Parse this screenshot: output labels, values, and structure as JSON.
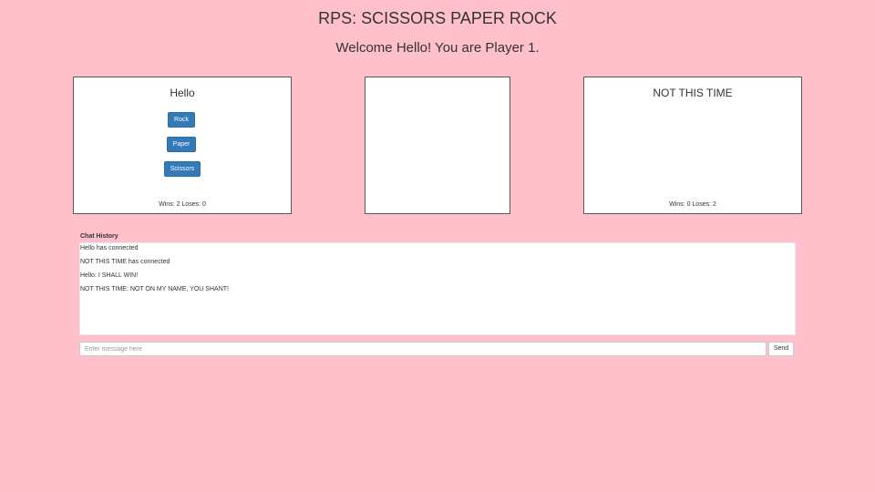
{
  "header": {
    "title": "RPS: SCISSORS PAPER ROCK",
    "welcome": "Welcome Hello! You are Player 1."
  },
  "player1": {
    "name": "Hello",
    "choices": [
      "Rock",
      "Paper",
      "Scissors"
    ],
    "record": "Wins: 2 Loses: 0"
  },
  "result": {
    "text": ""
  },
  "player2": {
    "name": "NOT THIS TIME",
    "record": "Wins: 0 Loses: 2"
  },
  "chat": {
    "label": "Chat History",
    "messages": [
      "Hello has connected",
      "NOT THIS TIME has connected",
      "Hello: I SHALL WIN!",
      "NOT THIS TIME: NOT ON MY NAME, YOU SHANT!"
    ],
    "input_placeholder": "Enter message here",
    "input_value": "",
    "send_label": "Send"
  },
  "colors": {
    "background": "#ffc0cb",
    "button_primary": "#337ab7"
  }
}
